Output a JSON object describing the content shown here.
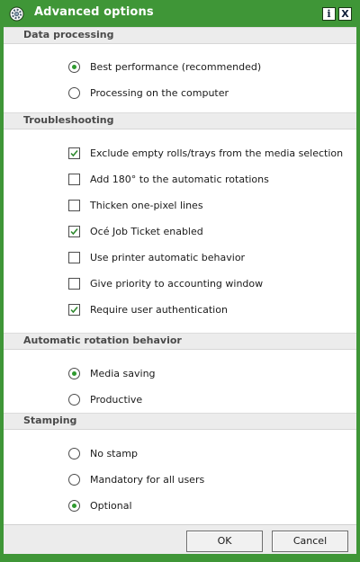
{
  "window": {
    "title": "Advanced options",
    "icon": "gear-icon",
    "accent": "#3f9637"
  },
  "titlebar_buttons": {
    "info": "i",
    "close": "X"
  },
  "sections": [
    {
      "title": "Data processing",
      "type": "radio",
      "options": [
        {
          "label": "Best performance (recommended)",
          "selected": true
        },
        {
          "label": "Processing on the computer",
          "selected": false
        }
      ]
    },
    {
      "title": "Troubleshooting",
      "type": "checkbox",
      "options": [
        {
          "label": "Exclude empty rolls/trays from the media selection",
          "checked": true
        },
        {
          "label": "Add 180° to the automatic rotations",
          "checked": false
        },
        {
          "label": "Thicken one-pixel lines",
          "checked": false
        },
        {
          "label": "Océ Job Ticket enabled",
          "checked": true
        },
        {
          "label": "Use printer automatic behavior",
          "checked": false
        },
        {
          "label": "Give priority to accounting window",
          "checked": false
        },
        {
          "label": "Require user authentication",
          "checked": true
        }
      ]
    },
    {
      "title": "Automatic rotation behavior",
      "type": "radio",
      "options": [
        {
          "label": "Media saving",
          "selected": true
        },
        {
          "label": "Productive",
          "selected": false
        }
      ]
    },
    {
      "title": "Stamping",
      "type": "radio",
      "options": [
        {
          "label": "No stamp",
          "selected": false
        },
        {
          "label": "Mandatory for all users",
          "selected": false
        },
        {
          "label": "Optional",
          "selected": true
        }
      ]
    }
  ],
  "footer": {
    "ok_label": "OK",
    "cancel_label": "Cancel"
  }
}
